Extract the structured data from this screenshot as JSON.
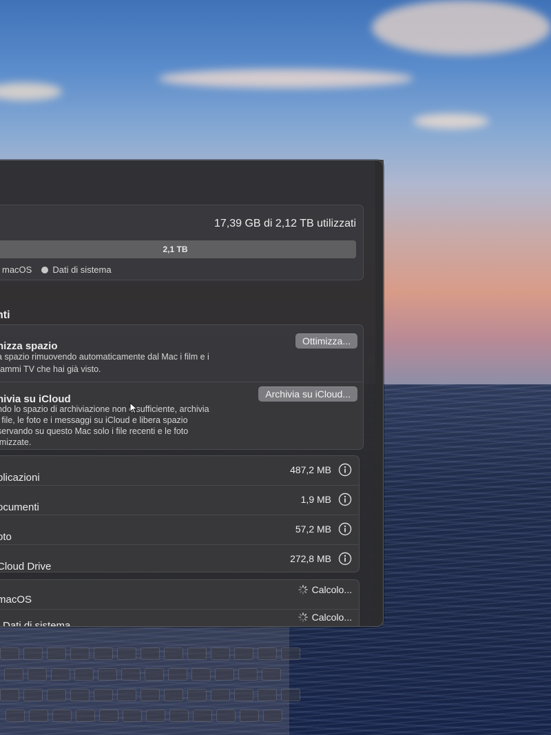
{
  "storage": {
    "title": "",
    "used_label": "17,39 GB di 2,12 TB utilizzati",
    "bar_label": "2,1 TB",
    "used_fraction": 0.008,
    "legend": [
      {
        "label": "macOS",
        "color": "#c8c8c8"
      },
      {
        "label": "Dati di sistema",
        "color": "#c8c8c8"
      }
    ]
  },
  "recommendations": {
    "heading": "nti",
    "optimize": {
      "title": "nizza spazio",
      "desc_line1": "a spazio rimuovendo automaticamente dal Mac i film e i",
      "desc_line2": "rammi TV che hai già visto.",
      "button": "Ottimizza..."
    },
    "icloud": {
      "title": "hivia su iCloud",
      "desc_line1": "ndo lo spazio di archiviazione non è sufficiente, archivia",
      "desc_line2": "i file, le foto e i messaggi su iCloud e libera spazio",
      "desc_line3": "servando su questo Mac solo i file recenti e le foto",
      "desc_line4": "imizzate.",
      "button": "Archivia su iCloud..."
    }
  },
  "categories": [
    {
      "name": "plicazioni",
      "size": "487,2 MB"
    },
    {
      "name": "ocumenti",
      "size": "1,9 MB"
    },
    {
      "name": "oto",
      "size": "57,2 MB"
    },
    {
      "name": "Cloud Drive",
      "size": "272,8 MB"
    }
  ],
  "system": [
    {
      "name": "macOS",
      "status": "Calcolo..."
    },
    {
      "name": "Dati di sistema",
      "status": "Calcolo..."
    }
  ],
  "colors": {
    "window_bg": "#2c2c2f",
    "group_bg": "#3a3a3d",
    "button_bg": "#7b7b80"
  },
  "icons": {
    "info": "info-circle-icon",
    "spinner": "loading-spinner-icon",
    "cursor": "mouse-pointer-icon"
  }
}
